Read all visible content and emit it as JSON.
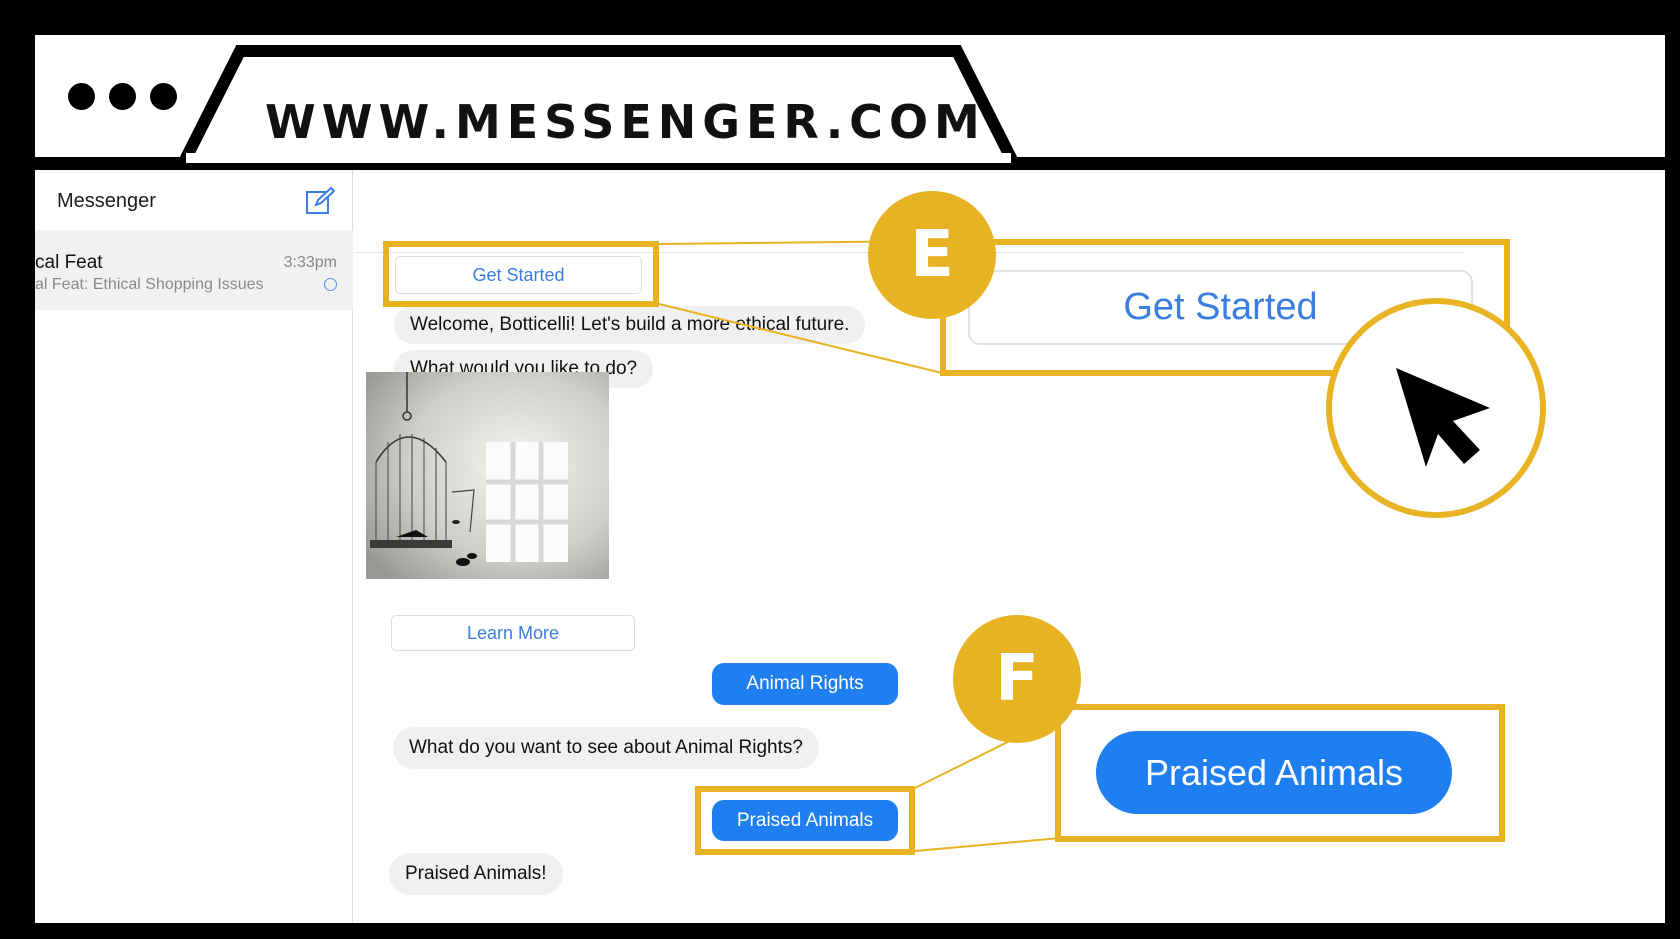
{
  "browser": {
    "url": "WWW.MESSENGER.COM"
  },
  "sidebar": {
    "title": "Messenger",
    "conversation": {
      "name": "cal Feat",
      "time": "3:33pm",
      "snippet": "al Feat: Ethical Shopping Issues"
    }
  },
  "chat": {
    "get_started_label": "Get Started",
    "welcome_text": "Welcome, Botticelli! Let's build a more ethical future.",
    "question_text": "What would you like to do?",
    "learn_more_label": "Learn More",
    "animal_rights_label": "Animal Rights",
    "animal_question_text": "What do you want to see about Animal Rights?",
    "praised_animals_label": "Praised Animals",
    "praised_reply_text": "Praised Animals!"
  },
  "callouts": {
    "e_badge": "E",
    "e_zoom_label": "Get Started",
    "f_badge": "F",
    "f_zoom_label": "Praised Animals"
  },
  "colors": {
    "accent_yellow": "#e7b323",
    "messenger_blue": "#1f7ff0",
    "link_blue": "#3b7de0"
  },
  "icons": {
    "compose": "compose-icon",
    "cursor": "cursor-arrow-icon",
    "unread": "unread-circle-icon"
  }
}
